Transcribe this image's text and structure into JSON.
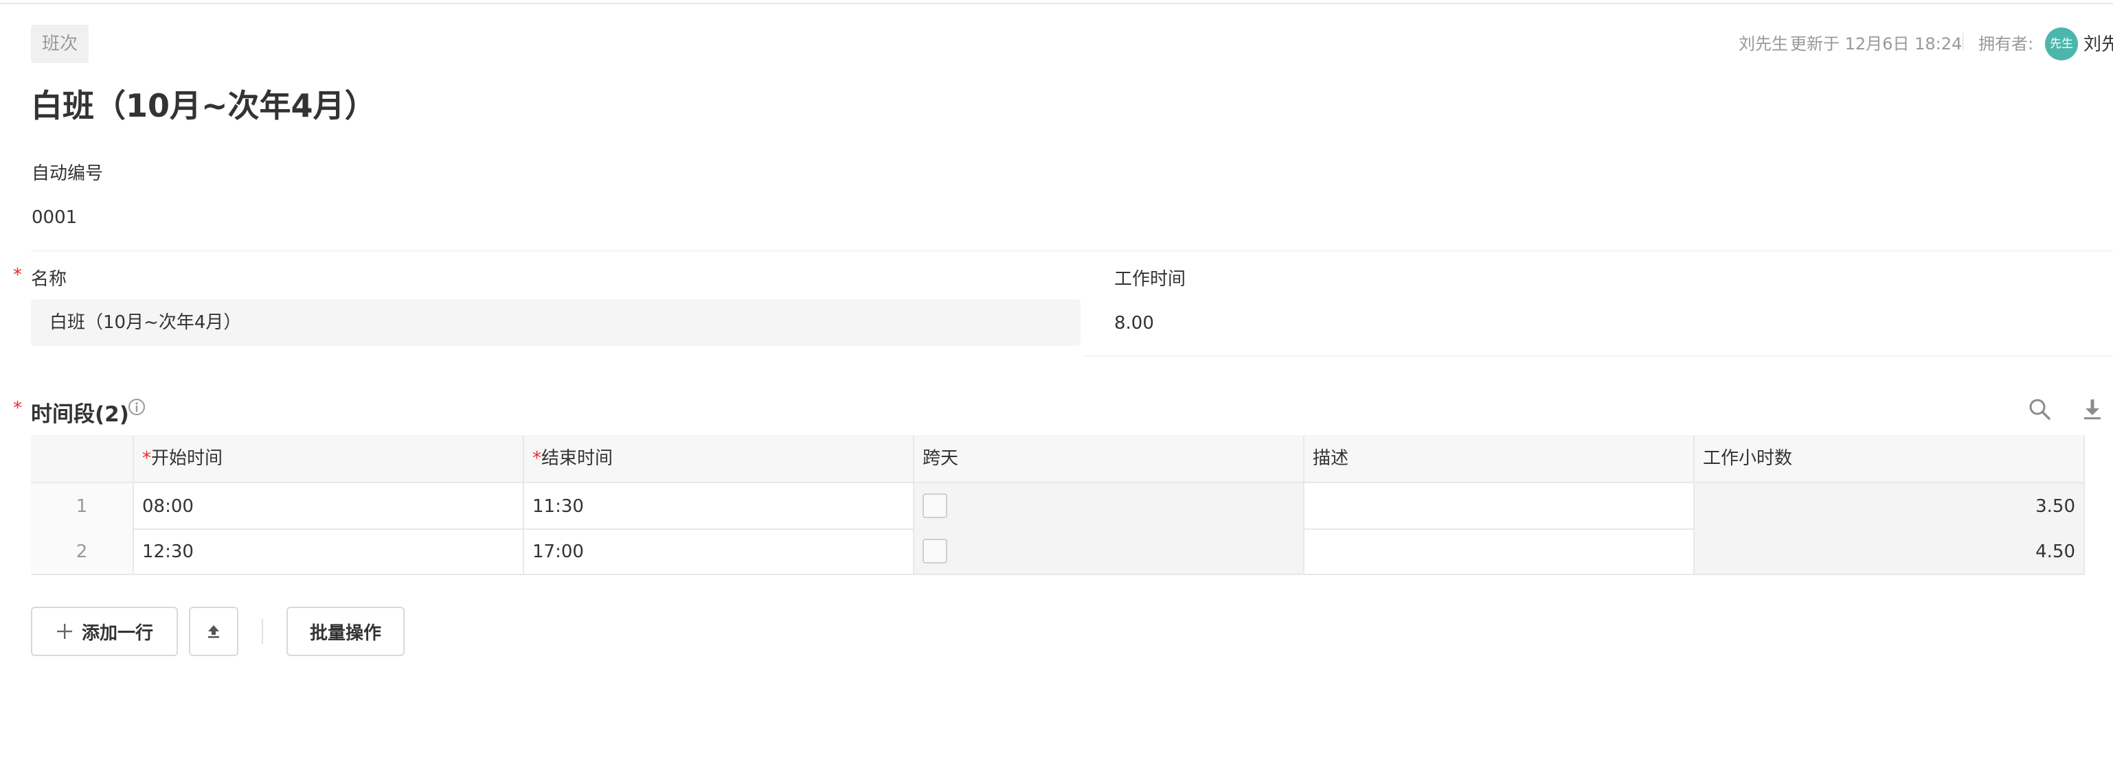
{
  "header": {
    "object_tag": "班次",
    "updater": "刘先生",
    "updated_at": "更新于 12月6日 18:24",
    "owner_label": "拥有者:",
    "owner_avatar_text": "先生",
    "owner_name": "刘先",
    "avatar_color": "#4db6ac"
  },
  "record": {
    "title": "白班（10月~次年4月）"
  },
  "fields": {
    "auto_number": {
      "label": "自动编号",
      "value": "0001"
    },
    "name": {
      "required_mark": "*",
      "label": "名称",
      "value": "白班（10月~次年4月）"
    },
    "work_time": {
      "label": "工作时间",
      "value": "8.00"
    }
  },
  "subtable": {
    "required_mark": "*",
    "title": "时间段(2)",
    "columns": [
      {
        "required_mark": "*",
        "label": "开始时间"
      },
      {
        "required_mark": "*",
        "label": "结束时间"
      },
      {
        "required_mark": "",
        "label": "跨天"
      },
      {
        "required_mark": "",
        "label": "描述"
      },
      {
        "required_mark": "",
        "label": "工作小时数"
      }
    ],
    "rows": [
      {
        "index": "1",
        "start": "08:00",
        "end": "11:30",
        "cross_day": false,
        "description": "",
        "hours": "3.50"
      },
      {
        "index": "2",
        "start": "12:30",
        "end": "17:00",
        "cross_day": false,
        "description": "",
        "hours": "4.50"
      }
    ]
  },
  "actions": {
    "add_row": "添加一行",
    "batch": "批量操作"
  },
  "colors": {
    "required": "#f5222d",
    "muted": "#999999",
    "text": "#333333"
  }
}
